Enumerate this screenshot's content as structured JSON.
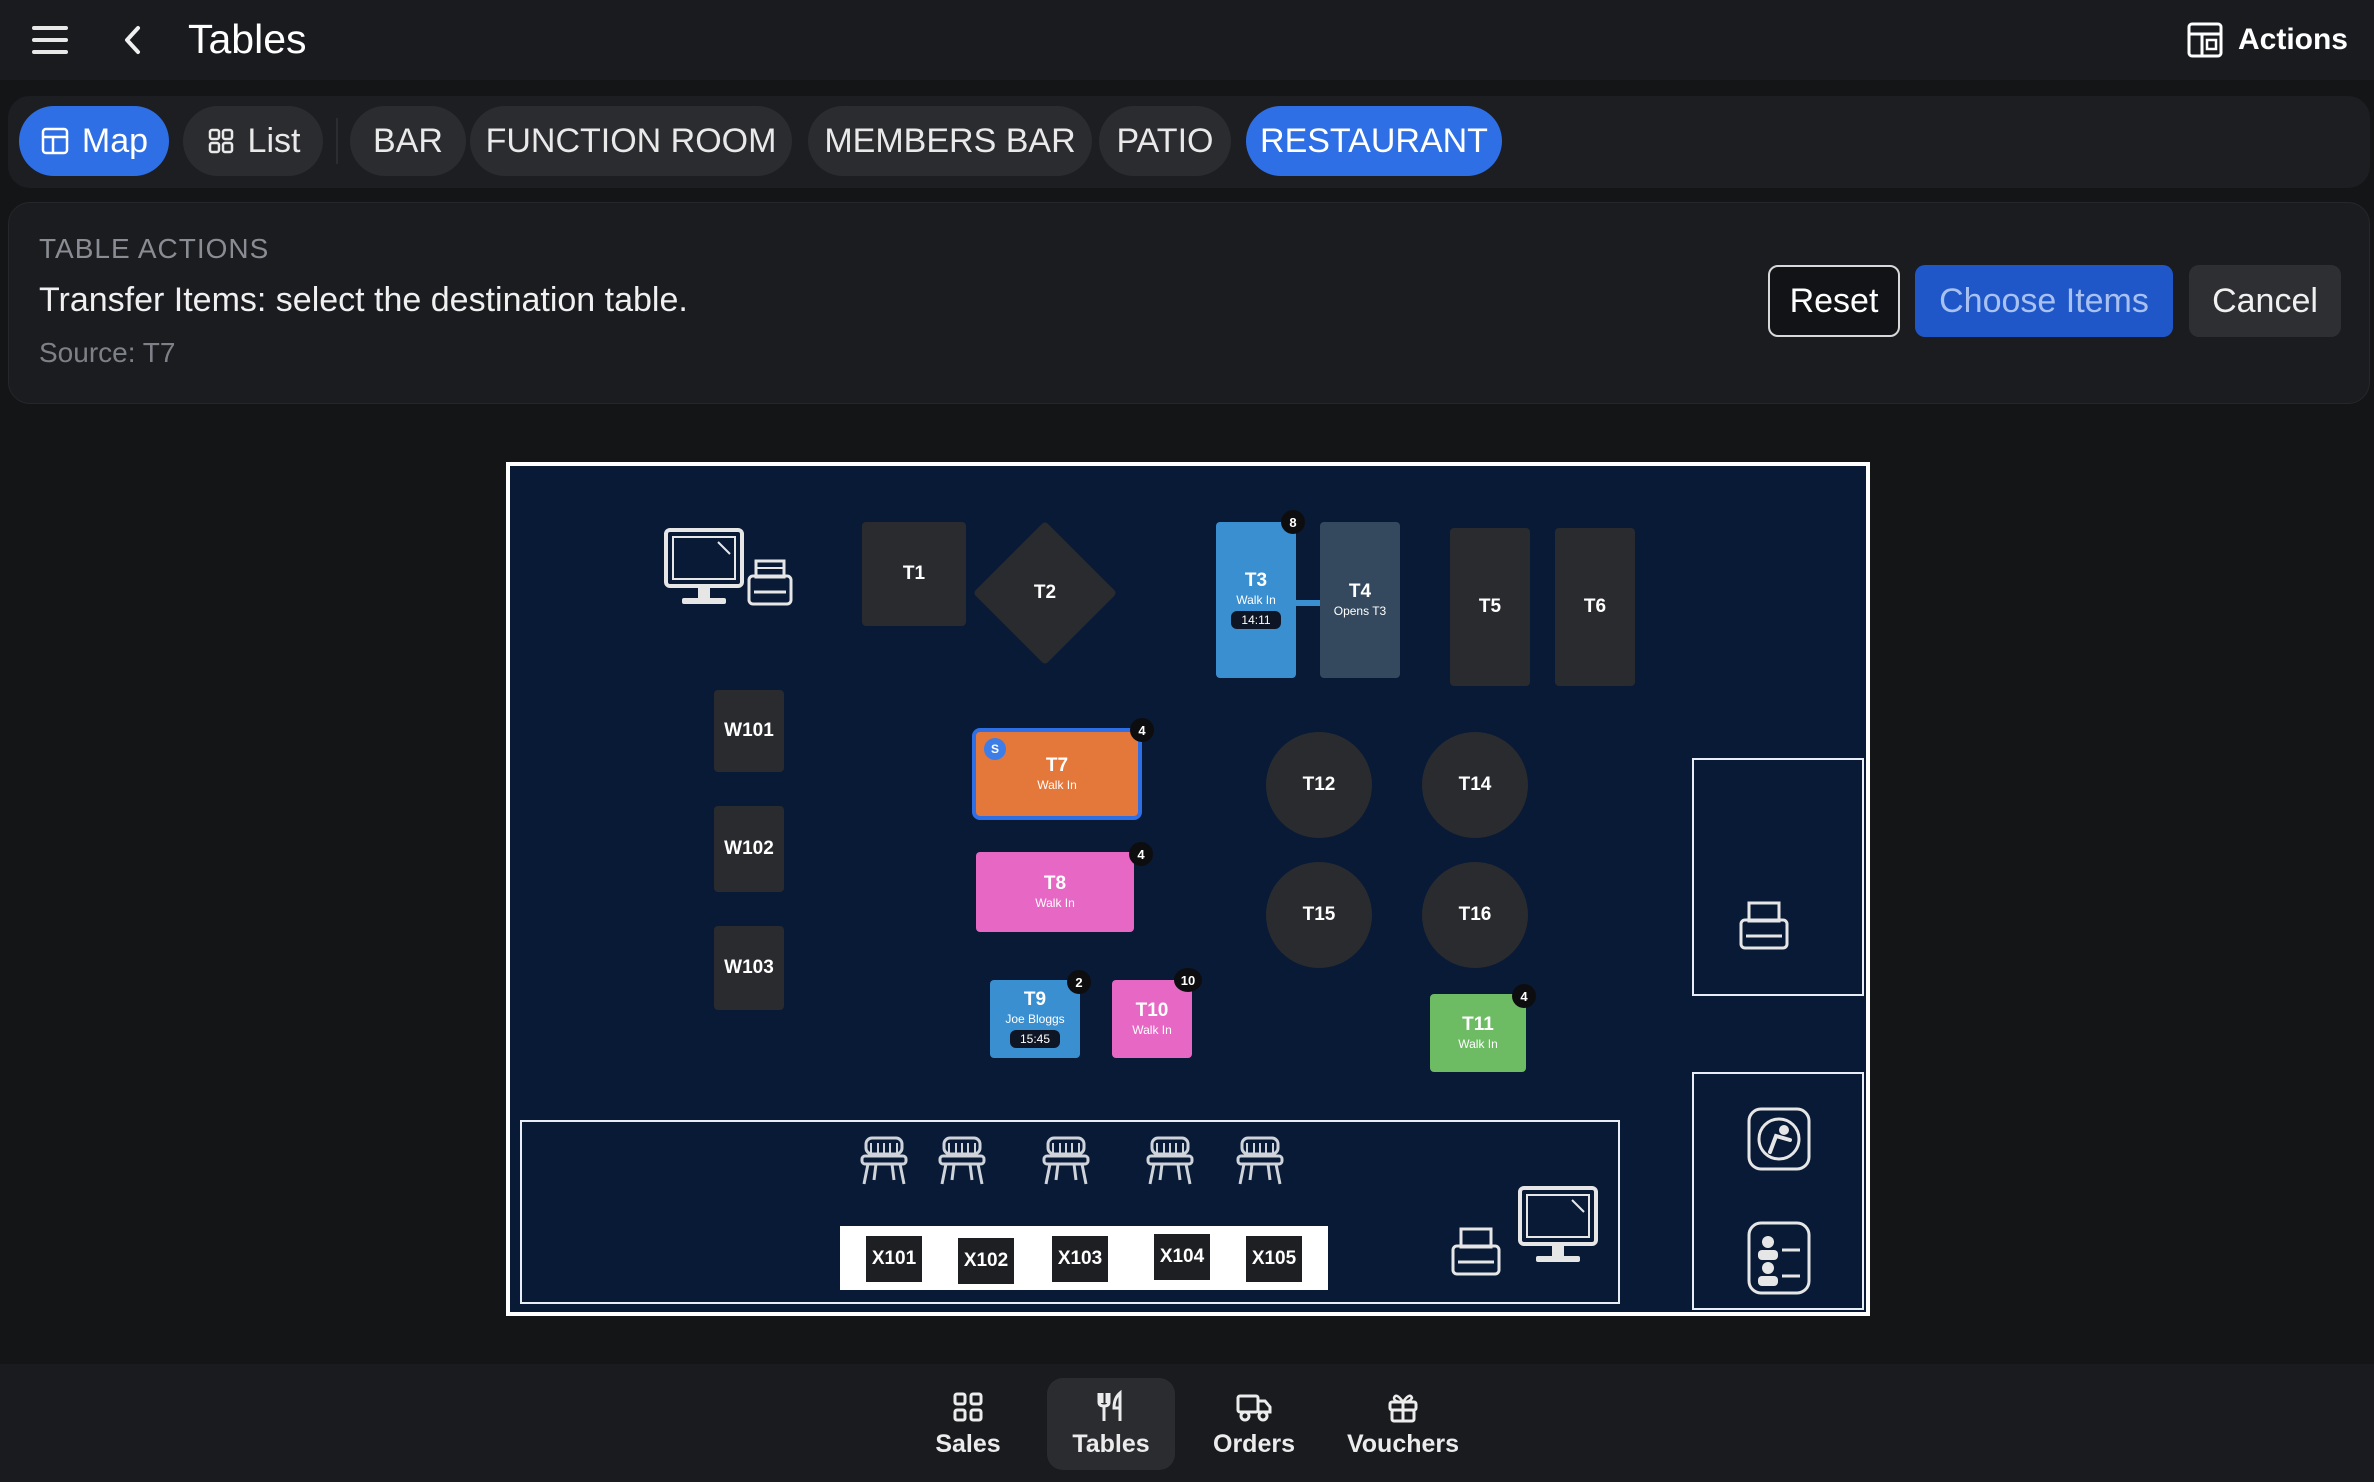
{
  "header": {
    "title": "Tables",
    "actions_label": "Actions"
  },
  "tabs": [
    {
      "label": "Map",
      "icon": "map-icon",
      "active": true
    },
    {
      "label": "List",
      "icon": "grid-icon",
      "active": false
    },
    {
      "label": "BAR",
      "active": false
    },
    {
      "label": "FUNCTION ROOM",
      "active": false
    },
    {
      "label": "MEMBERS BAR",
      "active": false
    },
    {
      "label": "PATIO",
      "active": false
    },
    {
      "label": "RESTAURANT",
      "active": true
    }
  ],
  "panel": {
    "caption": "TABLE ACTIONS",
    "message": "Transfer Items: select the destination table.",
    "source": "Source: T7",
    "reset_label": "Reset",
    "choose_label": "Choose Items",
    "cancel_label": "Cancel"
  },
  "floor": {
    "tables": {
      "T1": {
        "name": "T1"
      },
      "T2": {
        "name": "T2"
      },
      "T3": {
        "name": "T3",
        "status": "Walk In",
        "time": "14:11",
        "covers": "8",
        "color": "#3a8fd1"
      },
      "T4": {
        "name": "T4",
        "status": "Opens T3",
        "color": "#34495e"
      },
      "T5": {
        "name": "T5"
      },
      "T6": {
        "name": "T6"
      },
      "T7": {
        "name": "T7",
        "status": "Walk In",
        "covers": "4",
        "badge": "S",
        "color": "#e4773a"
      },
      "T8": {
        "name": "T8",
        "status": "Walk In",
        "covers": "4",
        "color": "#e668c4"
      },
      "T9": {
        "name": "T9",
        "status": "Joe Bloggs",
        "time": "15:45",
        "covers": "2",
        "color": "#3a8fd1"
      },
      "T10": {
        "name": "T10",
        "status": "Walk In",
        "covers": "10",
        "color": "#e668c4"
      },
      "T11": {
        "name": "T11",
        "status": "Walk In",
        "covers": "4",
        "color": "#6dbb63"
      },
      "T12": {
        "name": "T12"
      },
      "T14": {
        "name": "T14"
      },
      "T15": {
        "name": "T15"
      },
      "T16": {
        "name": "T16"
      },
      "W101": {
        "name": "W101"
      },
      "W102": {
        "name": "W102"
      },
      "W103": {
        "name": "W103"
      },
      "X101": {
        "name": "X101"
      },
      "X102": {
        "name": "X102"
      },
      "X103": {
        "name": "X103"
      },
      "X104": {
        "name": "X104"
      },
      "X105": {
        "name": "X105"
      }
    },
    "icons": [
      "pos-terminal-icon",
      "printer-icon",
      "bar-stool-icon",
      "rest-area-icon",
      "restroom-icon"
    ]
  },
  "bottom_nav": [
    {
      "label": "Sales",
      "icon": "grid-icon",
      "active": false
    },
    {
      "label": "Tables",
      "icon": "cutlery-icon",
      "active": true
    },
    {
      "label": "Orders",
      "icon": "delivery-truck-icon",
      "active": false
    },
    {
      "label": "Vouchers",
      "icon": "gift-icon",
      "active": false
    }
  ],
  "colors": {
    "accent": "#2f6fe6",
    "map_background": "#081a36",
    "surface": "#141517"
  }
}
